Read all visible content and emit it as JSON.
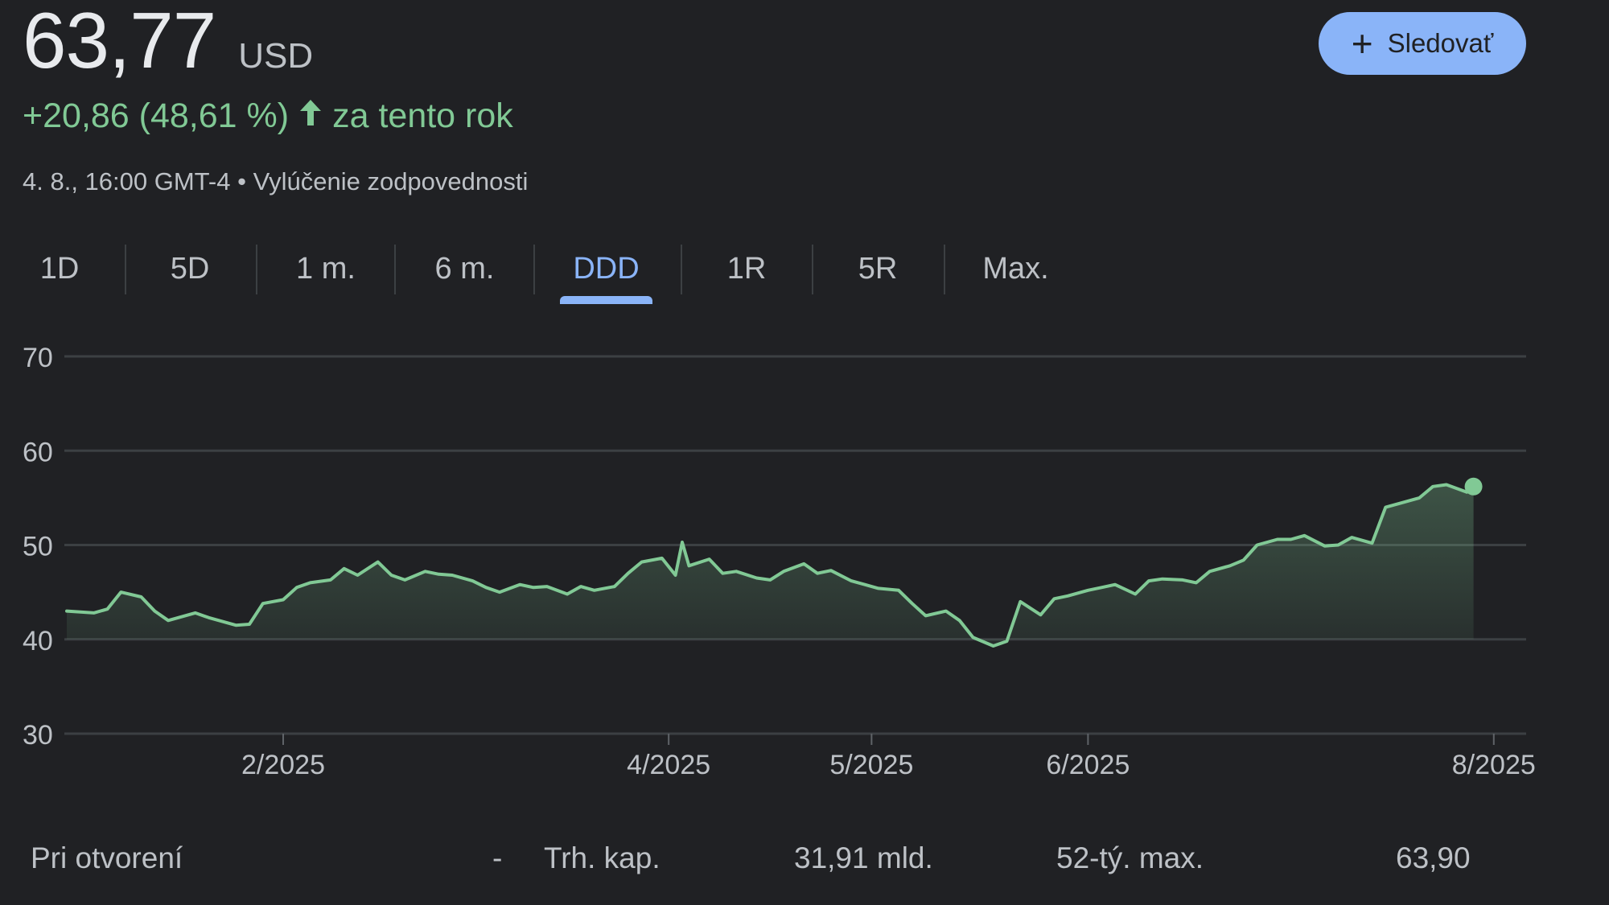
{
  "quote": {
    "price": "63,77",
    "currency": "USD",
    "change": "+20,86 (48,61 %)",
    "change_period": "za tento rok",
    "timestamp": "4. 8., 16:00 GMT-4",
    "separator": "•",
    "disclaimer": "Vylúčenie zodpovednosti",
    "follow_label": "Sledovať",
    "accent_color": "#8ab4f8",
    "positive_color": "#81c995"
  },
  "tabs": [
    {
      "label": "1D",
      "active": false
    },
    {
      "label": "5D",
      "active": false
    },
    {
      "label": "1 m.",
      "active": false
    },
    {
      "label": "6 m.",
      "active": false
    },
    {
      "label": "DDD",
      "active": true
    },
    {
      "label": "1R",
      "active": false
    },
    {
      "label": "5R",
      "active": false
    },
    {
      "label": "Max.",
      "active": false
    }
  ],
  "stats": [
    {
      "label": "Pri otvorení",
      "value": "-"
    },
    {
      "label": "Trh. kap.",
      "value": "31,91 mld."
    },
    {
      "label": "52-tý. max.",
      "value": "63,90"
    }
  ],
  "chart_data": {
    "type": "area",
    "ylim": [
      30,
      70
    ],
    "yticks": [
      "70",
      "60",
      "50",
      "40",
      "30"
    ],
    "ytick_values": [
      70,
      60,
      50,
      40,
      30
    ],
    "xticks": [
      {
        "label": "2/2025",
        "date": "2025-02-03"
      },
      {
        "label": "4/2025",
        "date": "2025-04-01"
      },
      {
        "label": "5/2025",
        "date": "2025-05-01"
      },
      {
        "label": "6/2025",
        "date": "2025-06-02"
      },
      {
        "label": "8/2025",
        "date": "2025-08-01"
      }
    ],
    "x_range": [
      "2025-01-02",
      "2025-08-04"
    ],
    "grid": true,
    "line_color": "#81c995",
    "series": [
      {
        "points": [
          [
            "2025-01-02",
            43.0
          ],
          [
            "2025-01-06",
            42.8
          ],
          [
            "2025-01-08",
            43.2
          ],
          [
            "2025-01-10",
            45.0
          ],
          [
            "2025-01-13",
            44.5
          ],
          [
            "2025-01-15",
            43.0
          ],
          [
            "2025-01-17",
            42.0
          ],
          [
            "2025-01-21",
            42.8
          ],
          [
            "2025-01-23",
            42.3
          ],
          [
            "2025-01-27",
            41.5
          ],
          [
            "2025-01-29",
            41.6
          ],
          [
            "2025-01-31",
            43.8
          ],
          [
            "2025-02-03",
            44.2
          ],
          [
            "2025-02-05",
            45.5
          ],
          [
            "2025-02-07",
            46.0
          ],
          [
            "2025-02-10",
            46.3
          ],
          [
            "2025-02-12",
            47.5
          ],
          [
            "2025-02-14",
            46.8
          ],
          [
            "2025-02-17",
            48.2
          ],
          [
            "2025-02-19",
            46.8
          ],
          [
            "2025-02-21",
            46.3
          ],
          [
            "2025-02-24",
            47.2
          ],
          [
            "2025-02-26",
            46.9
          ],
          [
            "2025-02-28",
            46.8
          ],
          [
            "2025-03-03",
            46.2
          ],
          [
            "2025-03-05",
            45.5
          ],
          [
            "2025-03-07",
            45.0
          ],
          [
            "2025-03-10",
            45.8
          ],
          [
            "2025-03-12",
            45.5
          ],
          [
            "2025-03-14",
            45.6
          ],
          [
            "2025-03-17",
            44.8
          ],
          [
            "2025-03-19",
            45.6
          ],
          [
            "2025-03-21",
            45.2
          ],
          [
            "2025-03-24",
            45.6
          ],
          [
            "2025-03-26",
            47.0
          ],
          [
            "2025-03-28",
            48.2
          ],
          [
            "2025-03-31",
            48.6
          ],
          [
            "2025-04-02",
            46.8
          ],
          [
            "2025-04-03",
            50.3
          ],
          [
            "2025-04-04",
            47.8
          ],
          [
            "2025-04-07",
            48.5
          ],
          [
            "2025-04-09",
            47.0
          ],
          [
            "2025-04-11",
            47.2
          ],
          [
            "2025-04-14",
            46.5
          ],
          [
            "2025-04-16",
            46.3
          ],
          [
            "2025-04-18",
            47.2
          ],
          [
            "2025-04-21",
            48.0
          ],
          [
            "2025-04-23",
            47.0
          ],
          [
            "2025-04-25",
            47.3
          ],
          [
            "2025-04-28",
            46.2
          ],
          [
            "2025-04-30",
            45.8
          ],
          [
            "2025-05-02",
            45.4
          ],
          [
            "2025-05-05",
            45.2
          ],
          [
            "2025-05-07",
            43.8
          ],
          [
            "2025-05-09",
            42.5
          ],
          [
            "2025-05-12",
            43.0
          ],
          [
            "2025-05-14",
            42.0
          ],
          [
            "2025-05-16",
            40.2
          ],
          [
            "2025-05-19",
            39.3
          ],
          [
            "2025-05-21",
            39.8
          ],
          [
            "2025-05-23",
            44.0
          ],
          [
            "2025-05-26",
            42.6
          ],
          [
            "2025-05-28",
            44.3
          ],
          [
            "2025-05-30",
            44.6
          ],
          [
            "2025-06-02",
            45.2
          ],
          [
            "2025-06-04",
            45.5
          ],
          [
            "2025-06-06",
            45.8
          ],
          [
            "2025-06-09",
            44.8
          ],
          [
            "2025-06-11",
            46.2
          ],
          [
            "2025-06-13",
            46.4
          ],
          [
            "2025-06-16",
            46.3
          ],
          [
            "2025-06-18",
            46.0
          ],
          [
            "2025-06-20",
            47.2
          ],
          [
            "2025-06-23",
            47.8
          ],
          [
            "2025-06-25",
            48.4
          ],
          [
            "2025-06-27",
            50.0
          ],
          [
            "2025-06-30",
            50.6
          ],
          [
            "2025-07-02",
            50.6
          ],
          [
            "2025-07-04",
            51.0
          ],
          [
            "2025-07-07",
            49.9
          ],
          [
            "2025-07-09",
            50.0
          ],
          [
            "2025-07-11",
            50.8
          ],
          [
            "2025-07-14",
            50.2
          ],
          [
            "2025-07-16",
            54.0
          ],
          [
            "2025-07-18",
            54.4
          ],
          [
            "2025-07-21",
            55.0
          ],
          [
            "2025-07-23",
            56.2
          ],
          [
            "2025-07-25",
            56.4
          ],
          [
            "2025-07-28",
            55.6
          ],
          [
            "2025-07-29",
            56.2
          ]
        ]
      }
    ]
  }
}
